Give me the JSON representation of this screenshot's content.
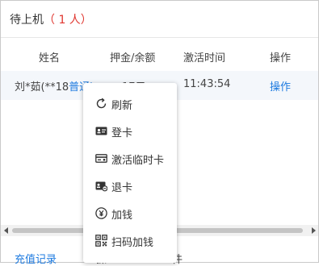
{
  "header": {
    "title": "待上机",
    "count": "（ 1 人）"
  },
  "table": {
    "columns": [
      "姓名",
      "押金/余额",
      "激活时间",
      "操作"
    ],
    "rows": [
      {
        "name": "刘*茹(**18",
        "level": "普通)",
        "deposit": "17元",
        "time": "11:43:54",
        "action": "操作"
      }
    ]
  },
  "footer": {
    "recharge": "充值记录",
    "mid": "操",
    "right": "件"
  },
  "context_menu": {
    "items": [
      {
        "label": "刷新",
        "icon": "refresh-icon"
      },
      {
        "label": "登卡",
        "icon": "card-login-icon"
      },
      {
        "label": "激活临时卡",
        "icon": "temp-card-icon"
      },
      {
        "label": "退卡",
        "icon": "card-return-icon"
      },
      {
        "label": "加钱",
        "icon": "yuan-coin-icon"
      },
      {
        "label": "扫码加钱",
        "icon": "qr-code-icon"
      }
    ]
  },
  "colors": {
    "accent": "#1e7be0",
    "count_red": "#e0362f",
    "row_bg": "#f4f7fb"
  }
}
